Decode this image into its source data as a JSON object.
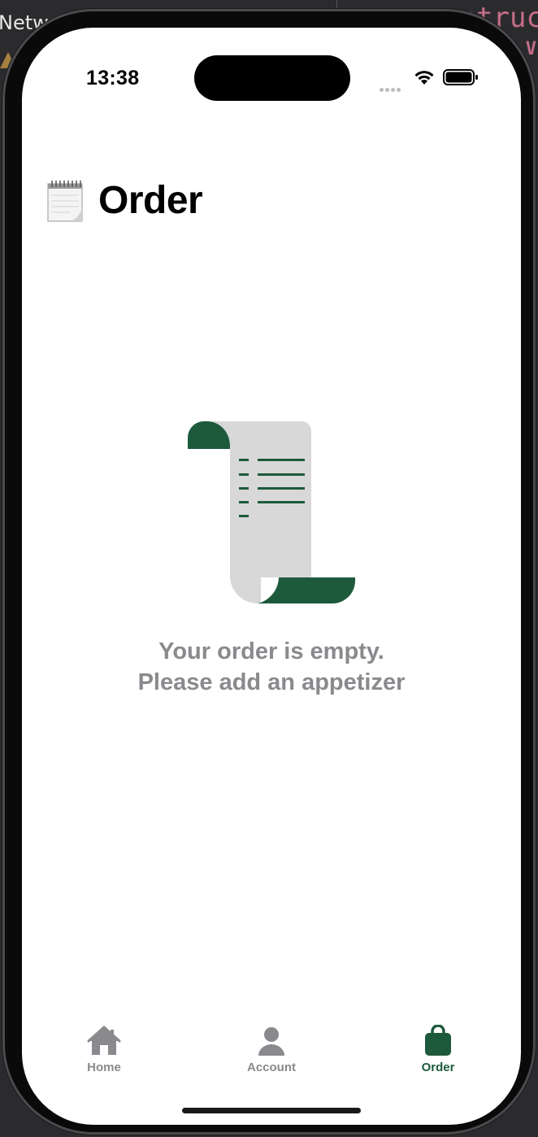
{
  "background": {
    "left_text": "Netw",
    "right_text": "struc",
    "right_glyph": "V"
  },
  "status_bar": {
    "time": "13:38"
  },
  "page": {
    "title_emoji_icon": "notepad-icon",
    "title": "Order"
  },
  "empty_state": {
    "illustration_icon": "receipt-scroll-icon",
    "line1": "Your order is empty.",
    "line2": "Please add an appetizer"
  },
  "tabbar": {
    "items": [
      {
        "label": "Home",
        "icon": "house-icon",
        "selected": false
      },
      {
        "label": "Account",
        "icon": "person-icon",
        "selected": false
      },
      {
        "label": "Order",
        "icon": "bag-icon",
        "selected": true
      }
    ]
  },
  "colors": {
    "accent": "#1d5a3c",
    "inactive": "#8a8a8e",
    "scroll_paper": "#d8d8d8"
  }
}
